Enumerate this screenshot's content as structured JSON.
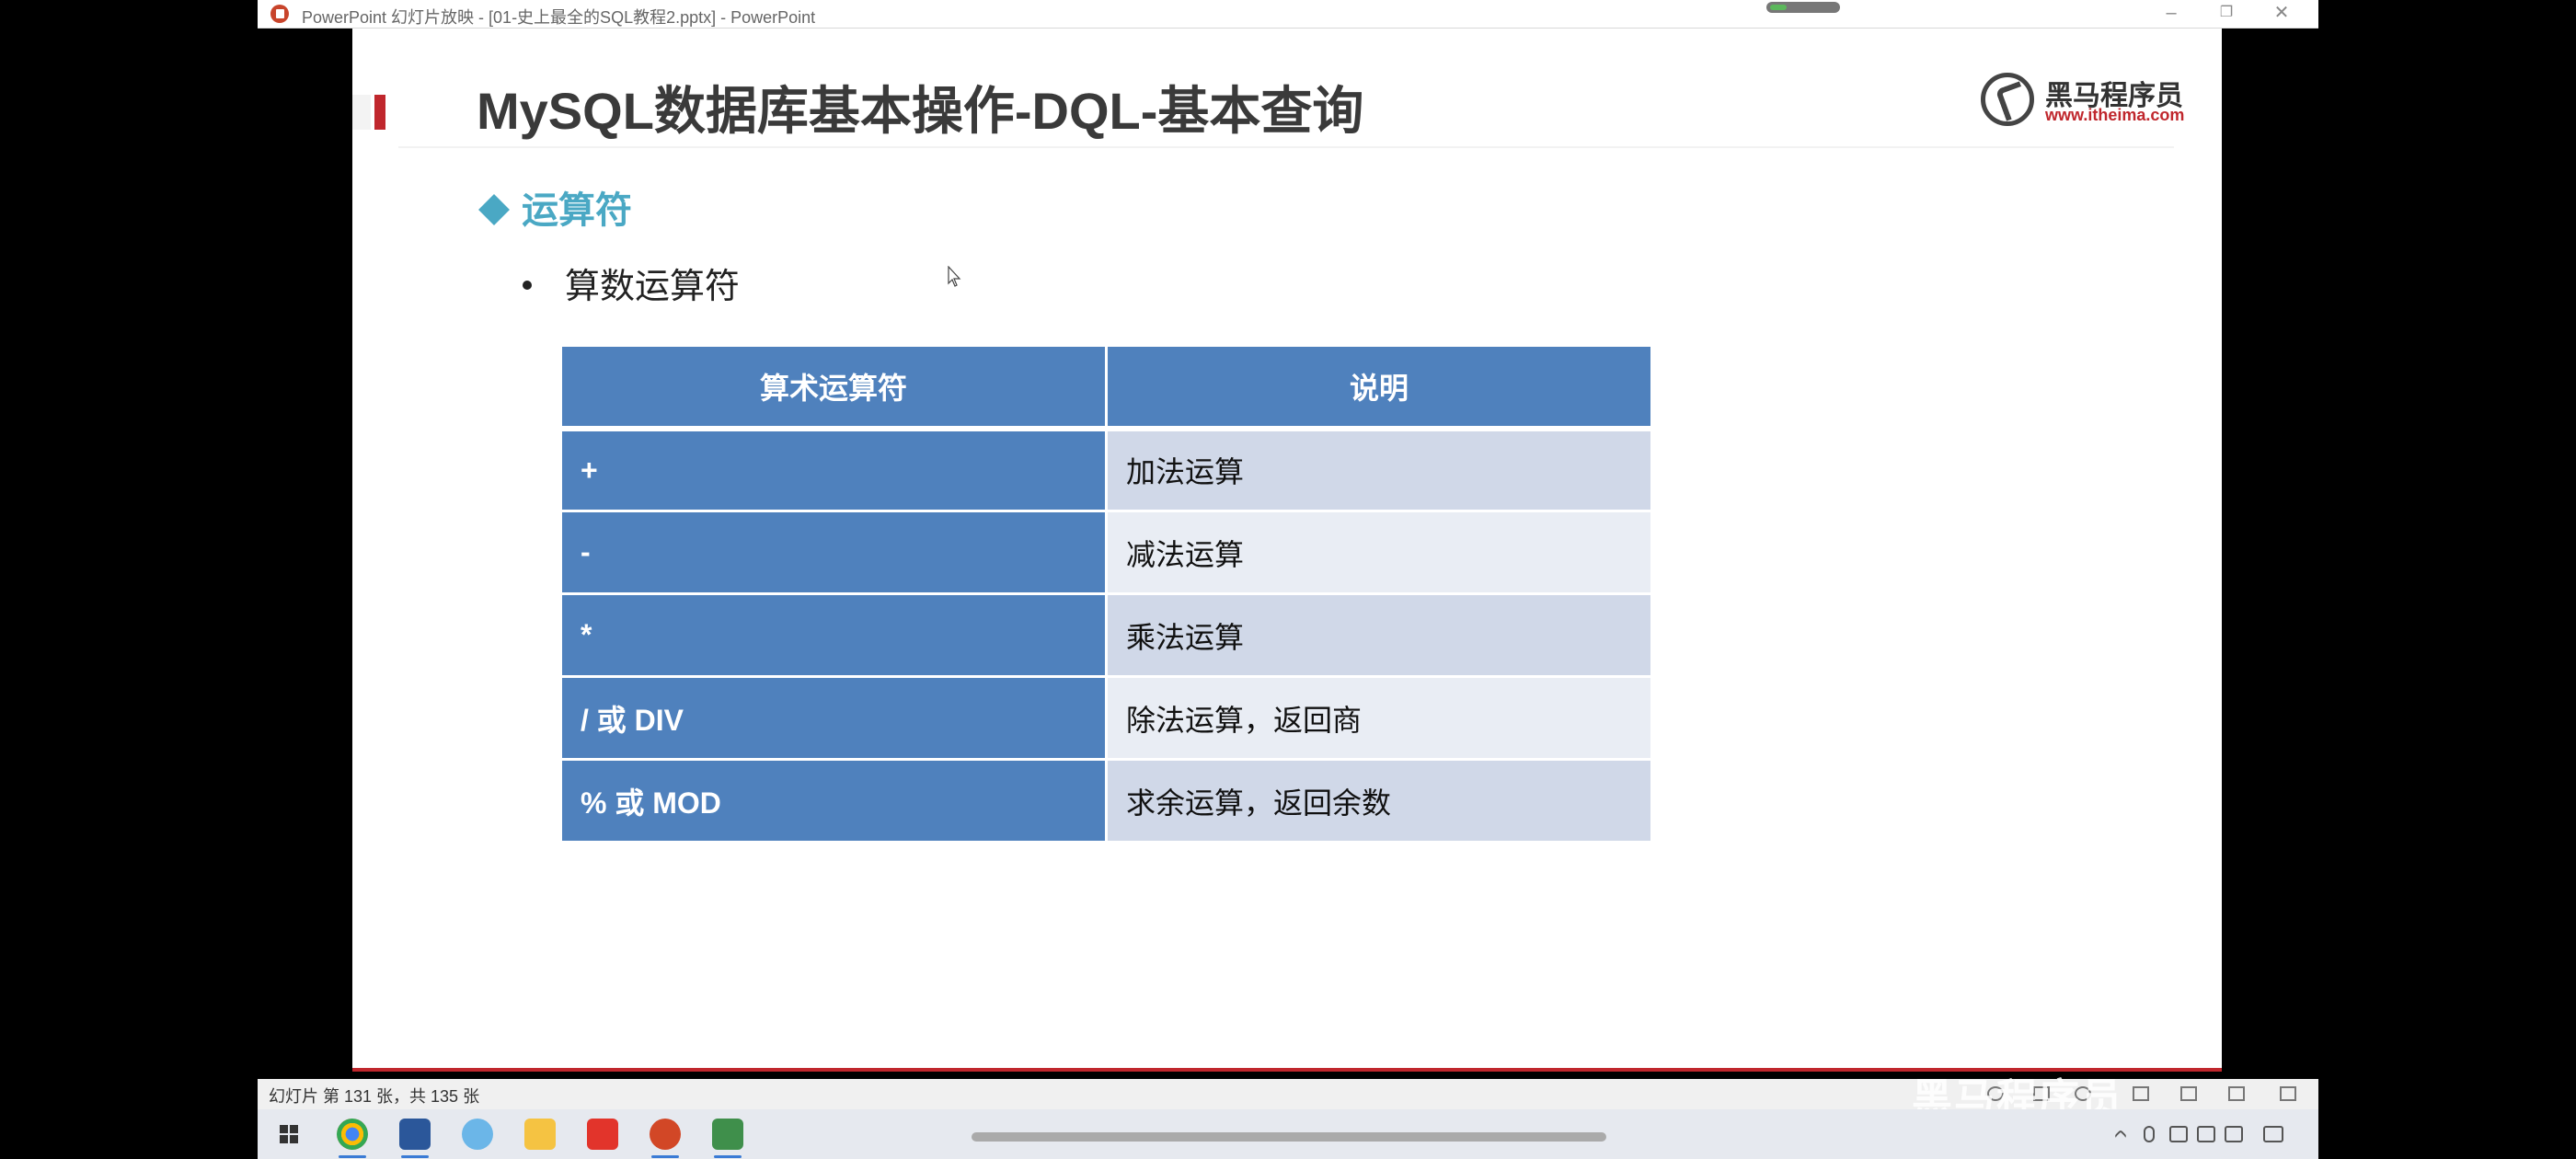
{
  "window": {
    "title": "PowerPoint 幻灯片放映 - [01-史上最全的SQL教程2.pptx] - PowerPoint"
  },
  "slide": {
    "title": "MySQL数据库基本操作-DQL-基本查询",
    "logo": {
      "brand": "黑马程序员",
      "url": "www.itheima.com"
    },
    "section_heading": "运算符",
    "bullet": "算数运算符",
    "table": {
      "headers": [
        "算术运算符",
        "说明"
      ],
      "rows": [
        {
          "operator": "+",
          "description": "加法运算"
        },
        {
          "operator": "-",
          "description": "减法运算"
        },
        {
          "operator": "*",
          "description": "乘法运算"
        },
        {
          "operator": "/ 或 DIV",
          "description": "除法运算，返回商"
        },
        {
          "operator": "% 或 MOD",
          "description": "求余运算，返回余数"
        }
      ]
    }
  },
  "statusbar": {
    "slide_info": "幻灯片 第 131 张，共 135 张",
    "watermark": "黑马程序员"
  },
  "taskbar": {
    "apps": [
      "chrome",
      "word",
      "browser",
      "file-explorer",
      "wps",
      "powerpoint",
      "editor"
    ]
  },
  "colors": {
    "table_header": "#4f81bd",
    "row_band_dark": "#d0d8e8",
    "row_band_light": "#e9edf4",
    "accent_red": "#c0272d",
    "section_blue": "#4aa8c4"
  }
}
